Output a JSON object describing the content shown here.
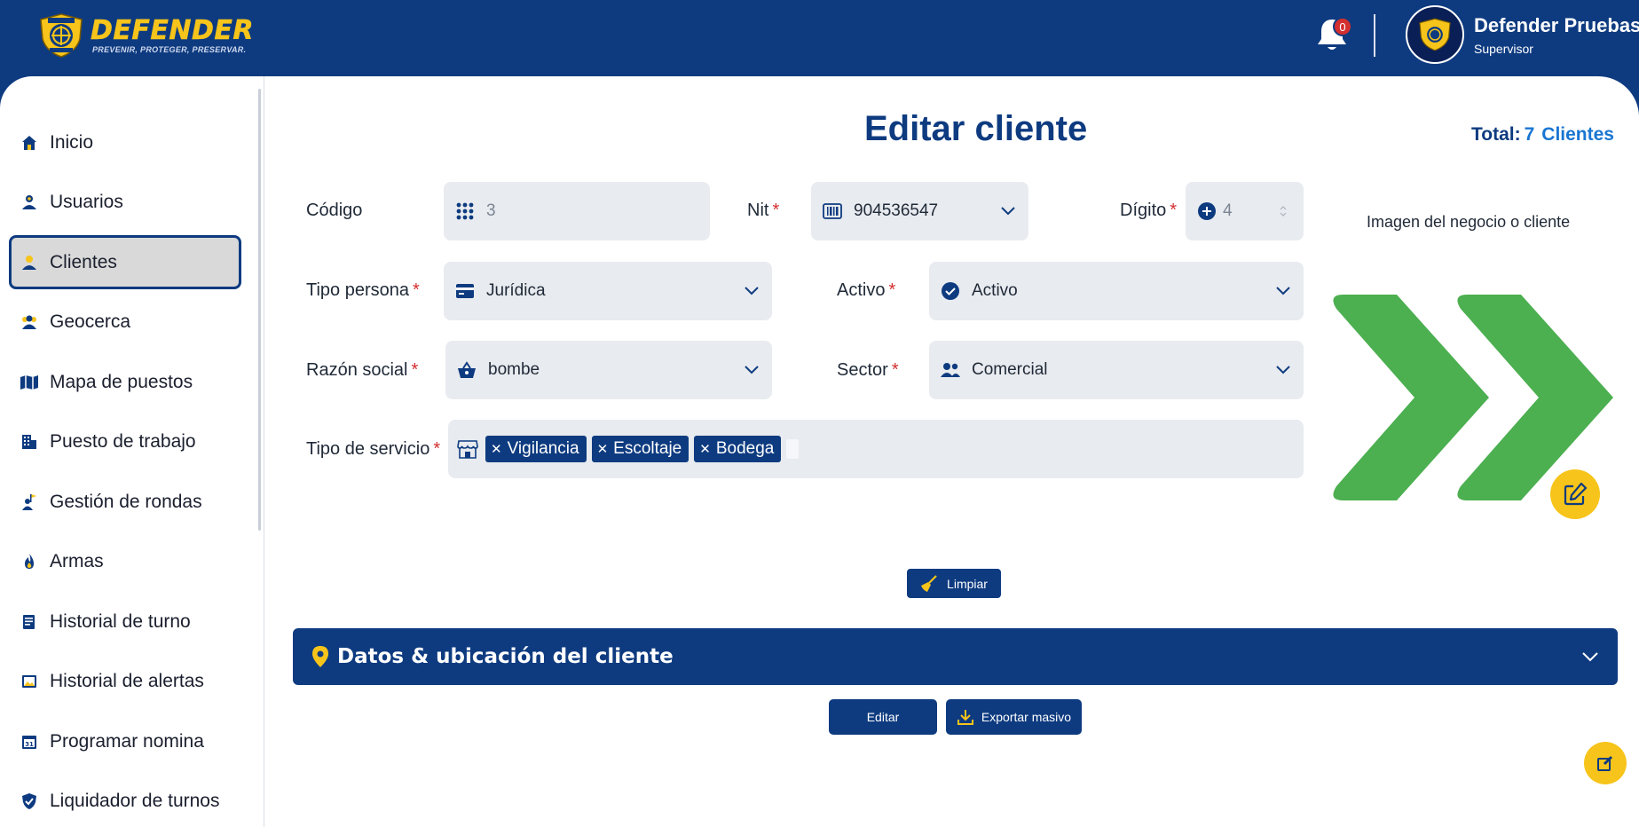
{
  "brand": {
    "name": "DEFENDER",
    "tagline": "PREVENIR, PROTEGER, PRESERVAR.",
    "primary_color": "#0e3b80",
    "accent_color": "#f6c41a"
  },
  "header": {
    "notification_count": "0",
    "user_name": "Defender Pruebas",
    "user_role": "Supervisor"
  },
  "sidebar": {
    "items": [
      {
        "label": "Inicio",
        "icon": "home-icon"
      },
      {
        "label": "Usuarios",
        "icon": "user-icon"
      },
      {
        "label": "Clientes",
        "icon": "clients-icon",
        "active": true
      },
      {
        "label": "Geocerca",
        "icon": "group-icon"
      },
      {
        "label": "Mapa de puestos",
        "icon": "map-icon"
      },
      {
        "label": "Puesto de trabajo",
        "icon": "building-icon"
      },
      {
        "label": "Gestión de rondas",
        "icon": "flag-person-icon"
      },
      {
        "label": "Armas",
        "icon": "fire-icon"
      },
      {
        "label": "Historial de turno",
        "icon": "document-icon"
      },
      {
        "label": "Historial de alertas",
        "icon": "image-icon"
      },
      {
        "label": "Programar nomina",
        "icon": "calendar-icon"
      },
      {
        "label": "Liquidador de turnos",
        "icon": "shield-check-icon"
      }
    ]
  },
  "main": {
    "title": "Editar cliente",
    "total": {
      "label": "Total:",
      "count": "7",
      "unit": "Clientes"
    },
    "form": {
      "codigo": {
        "label": "Código",
        "value": "3"
      },
      "nit": {
        "label": "Nit",
        "value": "904536547"
      },
      "digito": {
        "label": "Dígito",
        "value": "4"
      },
      "tipo_persona": {
        "label": "Tipo persona",
        "value": "Jurídica"
      },
      "activo": {
        "label": "Activo",
        "value": "Activo"
      },
      "razon_social": {
        "label": "Razón social",
        "value": "bombe"
      },
      "sector": {
        "label": "Sector",
        "value": "Comercial"
      },
      "tipo_servicio": {
        "label": "Tipo de servicio",
        "chips": [
          "Vigilancia",
          "Escoltaje",
          "Bodega"
        ]
      },
      "required_mark": "*"
    },
    "image_label": "Imagen del negocio o cliente",
    "buttons": {
      "limpiar": "Limpiar",
      "editar": "Editar",
      "exportar": "Exportar masivo"
    },
    "accordion": {
      "title": "Datos & ubicación del cliente"
    }
  }
}
